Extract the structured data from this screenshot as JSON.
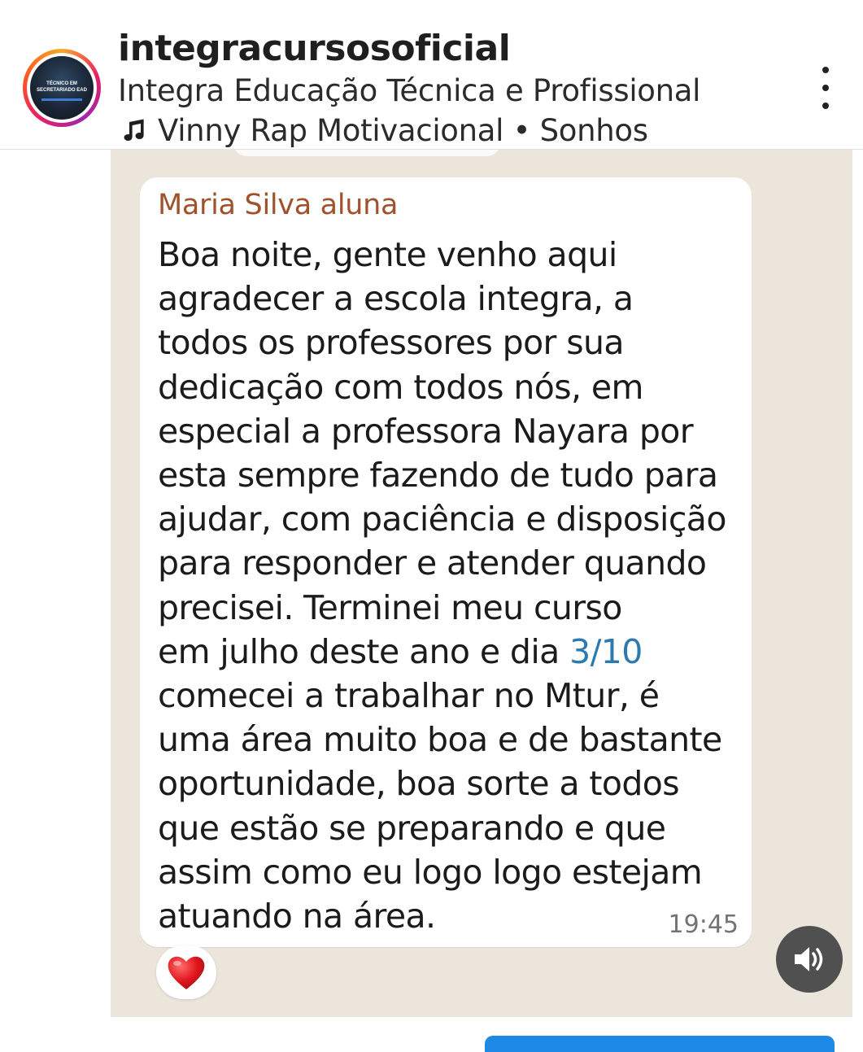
{
  "header": {
    "username": "integracursosoficial",
    "full_name": "Integra Educação Técnica e Profissional",
    "music": "Vinny Rap Motivacional • Sonhos",
    "avatar_text": "TÉCNICO EM SECRETARIADO EAD",
    "icons": {
      "music": "music-note-icon",
      "menu": "more-vert-icon"
    }
  },
  "message": {
    "sender": "Maria Silva aluna",
    "lines": [
      "Boa noite, gente venho aqui",
      "agradecer a escola integra, a",
      "todos os professores por sua",
      "dedicação com todos nós, em",
      "especial a professora Nayara por",
      "esta sempre fazendo de tudo para",
      "ajudar, com paciência e disposição",
      "para  responder e atender quando",
      "precisei. Terminei meu curso"
    ],
    "line_date_prefix": "em julho deste ano e dia ",
    "date_link": "3/10",
    "lines_after": [
      "comecei a trabalhar no Mtur, é",
      "uma área muito boa e de bastante",
      "oportunidade, boa sorte a todos",
      "que estão se preparando e que",
      "assim como eu logo logo estejam",
      "atuando na área."
    ],
    "time": "19:45",
    "reaction": "heart-icon"
  },
  "controls": {
    "sound_icon": "speaker-icon"
  },
  "colors": {
    "chat_background": "#ece5dc",
    "sender_name": "#a0522d",
    "link": "#2b7bb0",
    "reaction_heart": "#e0161e"
  }
}
